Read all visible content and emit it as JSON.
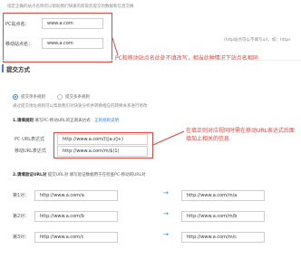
{
  "top_note": "指定正确的站点名称可以帮助我们快速的获取您提交的数据和信息交换",
  "domains": {
    "pc_label": "PC站点名：",
    "pc_value": "www.a.com",
    "mobile_label": "移动站点名：",
    "mobile_value": "www.a.com"
  },
  "side_note": "(http站点可以不填写url，如：https",
  "callout_domain": "PC和移动站点名此处不填改写，相当此种情况下站点名相同",
  "section": {
    "title": "提交方式"
  },
  "radios": [
    {
      "label": "提交单条规则",
      "selected": true
    },
    {
      "label": "提交多条规则",
      "selected": false
    }
  ],
  "sub_note": "通过提交地址规则可以帮助我们对快速分析并转换相应的转换关系进行修改",
  "step1": {
    "title": "1.请填规则",
    "text": "填写PC-移动URL的正则表达式",
    "link": "正则规则说明"
  },
  "rules": {
    "pc_label": "PC URL表达式",
    "pc_value": "http://www.a.com/(\\[a-z]+)",
    "mobile_label": "移动URL表达式",
    "mobile_value": "http://www.a.com/m/$(1)"
  },
  "callout_rule": "在填正则对应视同时需在移动URL表达式后面填加上相关的信息",
  "step2": {
    "title": "2.请填验证URL对",
    "text": "提交URL对 填写验证数据用于在检查PC-移动的URL对"
  },
  "pairs": [
    {
      "label": "第1对：",
      "pc": "http://www.a.com/a",
      "mobile": "http://www.a.com/m/a"
    },
    {
      "label": "第2对：",
      "pc": "http://www.a.com/b",
      "mobile": "http://www.a.com/m/b"
    },
    {
      "label": "第3对：",
      "pc": "http://www.a.com/c",
      "mobile": "http://www.a.com/m/c"
    }
  ],
  "arrow_glyph": "→",
  "colors": {
    "accent": "#3a86e8",
    "highlight": "#e8423a"
  }
}
